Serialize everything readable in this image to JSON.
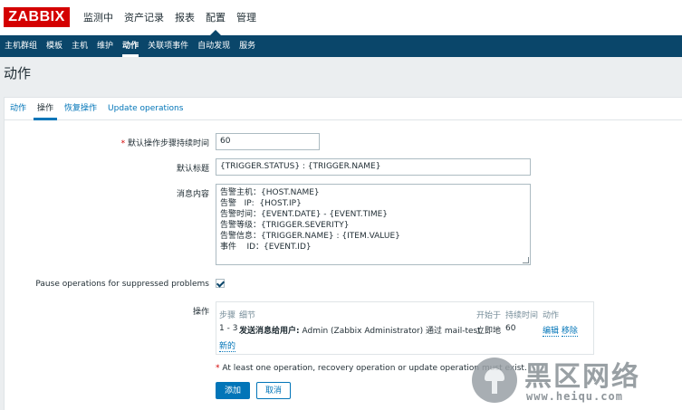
{
  "logo": "ZABBIX",
  "top_menu": [
    "监测中",
    "资产记录",
    "报表",
    "配置",
    "管理"
  ],
  "sub_menu": [
    "主机群组",
    "模板",
    "主机",
    "维护",
    "动作",
    "关联项事件",
    "自动发现",
    "服务"
  ],
  "page_title": "动作",
  "tabs": [
    "动作",
    "操作",
    "恢复操作",
    "Update operations"
  ],
  "form": {
    "duration_label": "默认操作步骤持续时间",
    "duration_value": "60",
    "subject_label": "默认标题",
    "subject_value": "{TRIGGER.STATUS} : {TRIGGER.NAME}",
    "message_label": "消息内容",
    "message_value": "告警主机：{HOST.NAME}\n告警   IP:  {HOST.IP}\n告警时间：{EVENT.DATE} - {EVENT.TIME}\n告警等级：{TRIGGER.SEVERITY}\n告警信息：{TRIGGER.NAME} : {ITEM.VALUE}\n事件    ID：{EVENT.ID}",
    "pause_label": "Pause operations for suppressed problems",
    "ops_label": "操作"
  },
  "ops_table": {
    "headers": [
      "步骤",
      "细节",
      "开始于",
      "持续时间",
      "动作"
    ],
    "row": {
      "steps": "1 - 3",
      "detail_bold": "发送消息给用户:",
      "detail": "Admin (Zabbix Administrator) 通过 mail-test",
      "start": "立即地",
      "duration": "60",
      "edit": "编辑",
      "remove": "移除"
    },
    "new_link": "新的"
  },
  "warning": "At least one operation, recovery operation or update operation must exist.",
  "buttons": {
    "add": "添加",
    "cancel": "取消"
  },
  "watermark": {
    "cn": "黑区网络",
    "url": "www.heiqu.com"
  },
  "colors": {
    "brand": "#d40000",
    "nav": "#0a466a",
    "link": "#0275b8"
  }
}
